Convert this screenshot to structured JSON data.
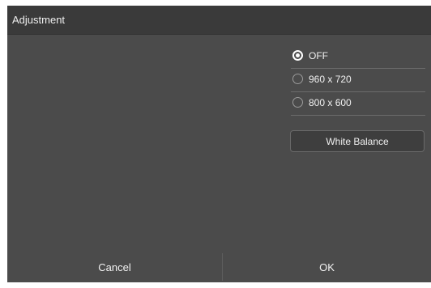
{
  "dialog": {
    "title": "Adjustment"
  },
  "options": [
    {
      "label": "OFF",
      "checked": true
    },
    {
      "label": "960 x 720",
      "checked": false
    },
    {
      "label": "800 x 600",
      "checked": false
    }
  ],
  "white_balance_label": "White Balance",
  "footer": {
    "cancel_label": "Cancel",
    "ok_label": "OK"
  }
}
